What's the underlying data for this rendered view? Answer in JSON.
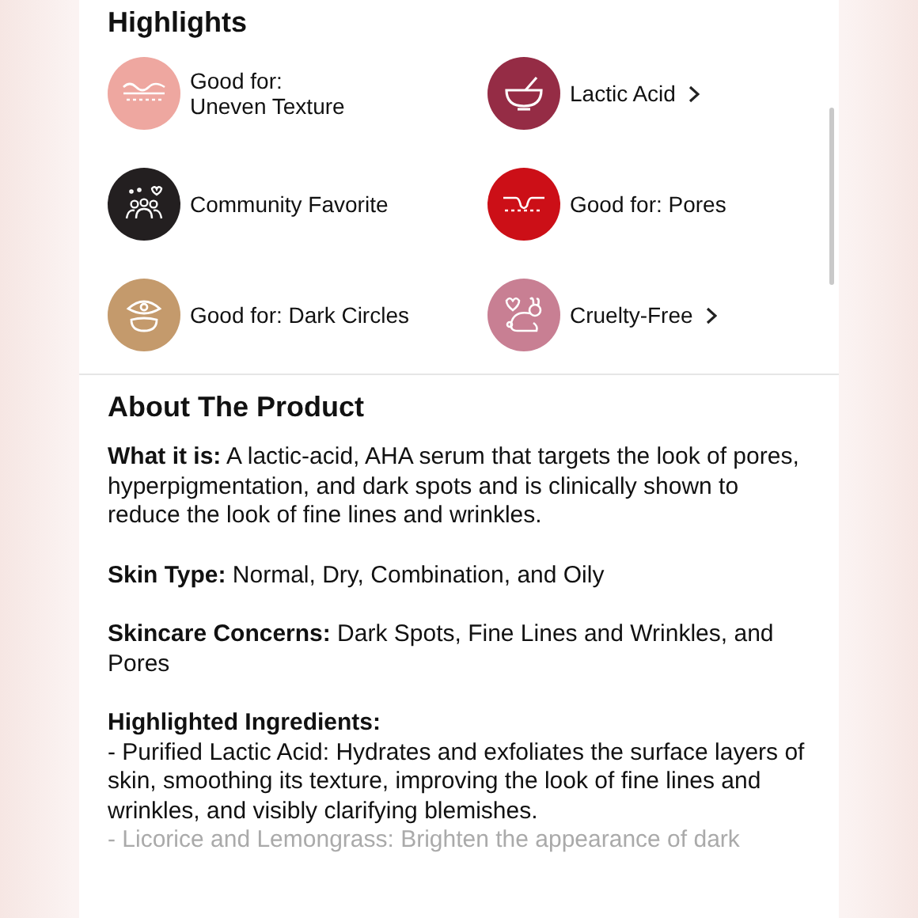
{
  "highlights": {
    "title": "Highlights",
    "items": [
      {
        "kind": "texture",
        "color": "#eea7a0",
        "label": "Good for:\nUneven Texture",
        "link": false
      },
      {
        "kind": "ingredient",
        "color": "#952c45",
        "label": "Lactic Acid",
        "link": true
      },
      {
        "kind": "community",
        "color": "#231f20",
        "label": "Community Favorite",
        "link": false
      },
      {
        "kind": "pores",
        "color": "#cc0f17",
        "label": "Good for: Pores",
        "link": false
      },
      {
        "kind": "dark-circles",
        "color": "#c49a6c",
        "label": "Good for: Dark Circles",
        "link": false
      },
      {
        "kind": "cruelty-free",
        "color": "#c87f93",
        "label": "Cruelty-Free",
        "link": true
      }
    ]
  },
  "about": {
    "title": "About The Product",
    "paragraphs": [
      "**What it is:** A lactic-acid, AHA serum that targets the look of pores, hyperpigmentation, and dark spots and is clinically shown to reduce the look of fine lines and wrinkles.",
      "**Skin Type:** Normal, Dry, Combination, and Oily",
      "**Skincare Concerns:** Dark Spots, Fine Lines and Wrinkles, and Pores"
    ],
    "ingredients": {
      "heading": "Highlighted Ingredients:",
      "lines": [
        "- Purified Lactic Acid: Hydrates and exfoliates the surface layers of skin, smoothing its texture, improving the look of fine lines and wrinkles, and visibly clarifying blemishes.",
        "- Licorice and Lemongrass: Brighten the appearance of dark"
      ]
    }
  }
}
